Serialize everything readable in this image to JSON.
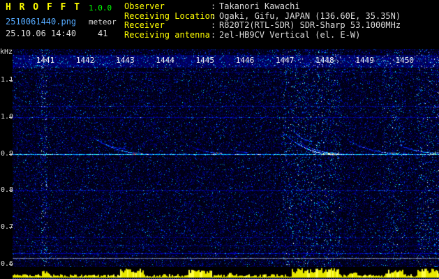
{
  "app": {
    "title": "H R O F F T",
    "version": "1.0.0",
    "filename": "2510061440.png",
    "mode": "meteor",
    "datetime": "25.10.06 14:40",
    "counter": "41"
  },
  "info": {
    "rows": [
      {
        "label": "Observer",
        "sep": ":",
        "value": "Takanori Kawachi"
      },
      {
        "label": "Receiving Location",
        "sep": ":",
        "value": "Ogaki, Gifu, JAPAN (136.60E, 35.35N)"
      },
      {
        "label": "Receiver",
        "sep": ":",
        "value": "R820T2(RTL-SDR) SDR-Sharp 53.1000MHz"
      },
      {
        "label": "Receiving antenna",
        "sep": ":",
        "value": "2el-HB9CV Vertical (el. E-W)"
      }
    ]
  },
  "spectrogram": {
    "y_axis_unit": "kHz",
    "y_ticks": [
      1.1,
      1.0,
      0.9,
      0.8,
      0.7,
      0.6
    ],
    "x_ticks": [
      1441,
      1442,
      1443,
      1444,
      1445,
      1446,
      1447,
      1448,
      1449,
      1450
    ],
    "carrier_lines": [
      {
        "khz": 1.122,
        "strength": 0.16
      },
      {
        "khz": 1.03,
        "strength": 0.22
      },
      {
        "khz": 1.0,
        "strength": 0.28
      },
      {
        "khz": 0.9,
        "strength": 0.95
      },
      {
        "khz": 0.8,
        "strength": 0.3
      },
      {
        "khz": 0.674,
        "strength": 0.15
      },
      {
        "khz": 0.652,
        "strength": 0.2
      },
      {
        "khz": 0.63,
        "strength": 0.38
      },
      {
        "khz": 0.617,
        "strength": 0.55,
        "white": true
      }
    ],
    "echoes": [
      {
        "t0": 1442.15,
        "t1": 1443.0,
        "f0": 0.948,
        "f1": 0.916,
        "strength": 0.3,
        "hotspot": false
      },
      {
        "t0": 1442.3,
        "t1": 1443.45,
        "f0": 0.938,
        "f1": 0.902,
        "strength": 0.55,
        "hotspot": true
      },
      {
        "t0": 1444.55,
        "t1": 1445.4,
        "f0": 0.926,
        "f1": 0.903,
        "strength": 0.4,
        "hotspot": true
      },
      {
        "t0": 1445.6,
        "t1": 1446.05,
        "f0": 0.915,
        "f1": 0.905,
        "strength": 0.3,
        "hotspot": false
      },
      {
        "t0": 1446.95,
        "t1": 1448.2,
        "f0": 0.958,
        "f1": 0.9,
        "strength": 0.95,
        "hotspot": true
      },
      {
        "t0": 1447.1,
        "t1": 1447.7,
        "f0": 0.978,
        "f1": 0.935,
        "strength": 0.45,
        "hotspot": false
      },
      {
        "t0": 1447.35,
        "t1": 1448.35,
        "f0": 0.932,
        "f1": 0.902,
        "strength": 0.6,
        "hotspot": true
      },
      {
        "t0": 1448.6,
        "t1": 1449.85,
        "f0": 0.936,
        "f1": 0.902,
        "strength": 0.55,
        "hotspot": true
      },
      {
        "t0": 1449.85,
        "t1": 1450.85,
        "f0": 0.924,
        "f1": 0.903,
        "strength": 0.7,
        "hotspot": true
      }
    ],
    "noise_bursts": [
      {
        "t0": 1440.9,
        "t1": 1441.03,
        "boost": 0.9
      },
      {
        "t0": 1446.95,
        "t1": 1448.4,
        "boost": 0.45
      },
      {
        "t0": 1449.45,
        "t1": 1449.95,
        "boost": 0.3
      },
      {
        "t0": 1450.3,
        "t1": 1450.9,
        "boost": 0.45
      }
    ]
  },
  "activity": {
    "color": "#e8e800",
    "bursts": [
      {
        "t0": 1440.9,
        "t1": 1441.1,
        "h": 10
      },
      {
        "t0": 1442.85,
        "t1": 1443.45,
        "h": 13
      },
      {
        "t0": 1444.55,
        "t1": 1445.15,
        "h": 12
      },
      {
        "t0": 1445.55,
        "t1": 1445.7,
        "h": 8
      },
      {
        "t0": 1447.15,
        "t1": 1448.35,
        "h": 14
      },
      {
        "t0": 1448.6,
        "t1": 1448.8,
        "h": 8
      },
      {
        "t0": 1449.5,
        "t1": 1449.95,
        "h": 12
      },
      {
        "t0": 1450.3,
        "t1": 1450.88,
        "h": 13
      }
    ]
  },
  "colors": {
    "background": "#000000",
    "title_yellow": "#ffff00",
    "version_green": "#00ff00",
    "filename_blue": "#55aaff",
    "text_white": "#dcdcdc",
    "carrier_cyan": "#00ffff",
    "activity_yellow": "#e8e800"
  }
}
